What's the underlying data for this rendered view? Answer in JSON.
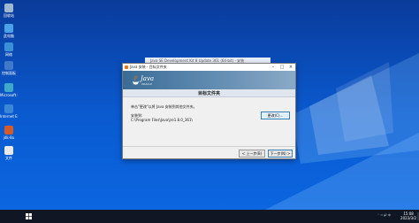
{
  "colors": {
    "desktop": "#0a5ad0",
    "taskbar": "#101623",
    "banner": "#3a6c95",
    "java_orange": "#e8731a"
  },
  "desktop_icons": [
    {
      "label": "回收站",
      "icon": "recycle-bin-icon",
      "color": "#9fb7cf"
    },
    {
      "label": "此电脑",
      "icon": "this-pc-icon",
      "color": "#4aa3e8"
    },
    {
      "label": "网络",
      "icon": "network-icon",
      "color": "#3b8fd6"
    },
    {
      "label": "控制面板",
      "icon": "control-panel-icon",
      "color": "#3f79c9"
    },
    {
      "label": "Microsoft Edge",
      "icon": "edge-icon",
      "color": "#3fa8c9"
    },
    {
      "label": "Internet Explorer",
      "icon": "ie-icon",
      "color": "#3b86d6"
    },
    {
      "label": "jdk-8u",
      "icon": "java-installer-icon",
      "color": "#d45a2a"
    },
    {
      "label": "文件",
      "icon": "file-icon",
      "color": "#e9e9e9"
    }
  ],
  "ghost_window": {
    "title": "Java SE Development Kit 8 Update 361 (64-bit) - 安装"
  },
  "dialog": {
    "title": "Java 安装 - 目标文件夹",
    "brand": {
      "word": "Java",
      "vendor": "ORACLE"
    },
    "header": "目标文件夹",
    "instruction": "单击\"更改\"以将 Java 安装到其他文件夹。",
    "folder_label": "安装到:",
    "folder_path": "C:\\Program Files\\Java\\jre1.8.0_361\\",
    "change_button": "更改(C)...",
    "back_button": "< 上一步(B)",
    "next_button": "下一步(N) >"
  },
  "taskbar": {
    "tray_text": "⌃ ▭ 🔊 中",
    "time": "15:08",
    "date": "2023/3/2"
  }
}
